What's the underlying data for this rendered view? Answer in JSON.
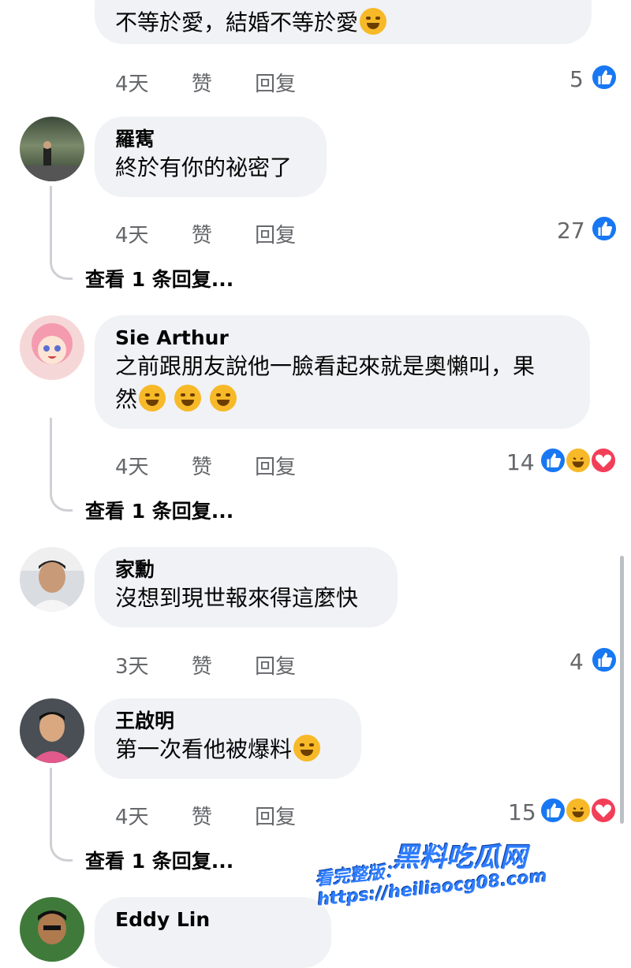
{
  "comments": [
    {
      "author": "",
      "text": "不等於愛，結婚不等於愛",
      "time": "4天",
      "like": "赞",
      "reply": "回复",
      "reactions": "5"
    },
    {
      "author": "羅寯",
      "text": "終於有你的祕密了",
      "time": "4天",
      "like": "赞",
      "reply": "回复",
      "reactions": "27",
      "more": "查看 1 条回复..."
    },
    {
      "author": "Sie Arthur",
      "text_line1": "之前跟朋友說他一臉看起來就是奧懶叫，果",
      "text_line2": "然",
      "time": "4天",
      "like": "赞",
      "reply": "回复",
      "reactions": "14",
      "more": "查看 1 条回复..."
    },
    {
      "author": "家勳",
      "text": "沒想到現世報來得這麼快",
      "time": "3天",
      "like": "赞",
      "reply": "回复",
      "reactions": "4"
    },
    {
      "author": "王啟明",
      "text": "第一次看他被爆料",
      "time": "4天",
      "like": "赞",
      "reply": "回复",
      "reactions": "15",
      "more": "查看 1 条回复..."
    },
    {
      "author": "Eddy Lin",
      "text": ""
    }
  ],
  "watermark": {
    "brand": "黑料吃瓜网",
    "url_line": "看完整版：https://heiliaocg08.com"
  },
  "colors": {
    "bubble": "#f0f2f5",
    "meta_text": "#65676b",
    "like_blue": "#1877f2",
    "haha_yellow": "#f7b928",
    "love_red": "#f33e58"
  }
}
